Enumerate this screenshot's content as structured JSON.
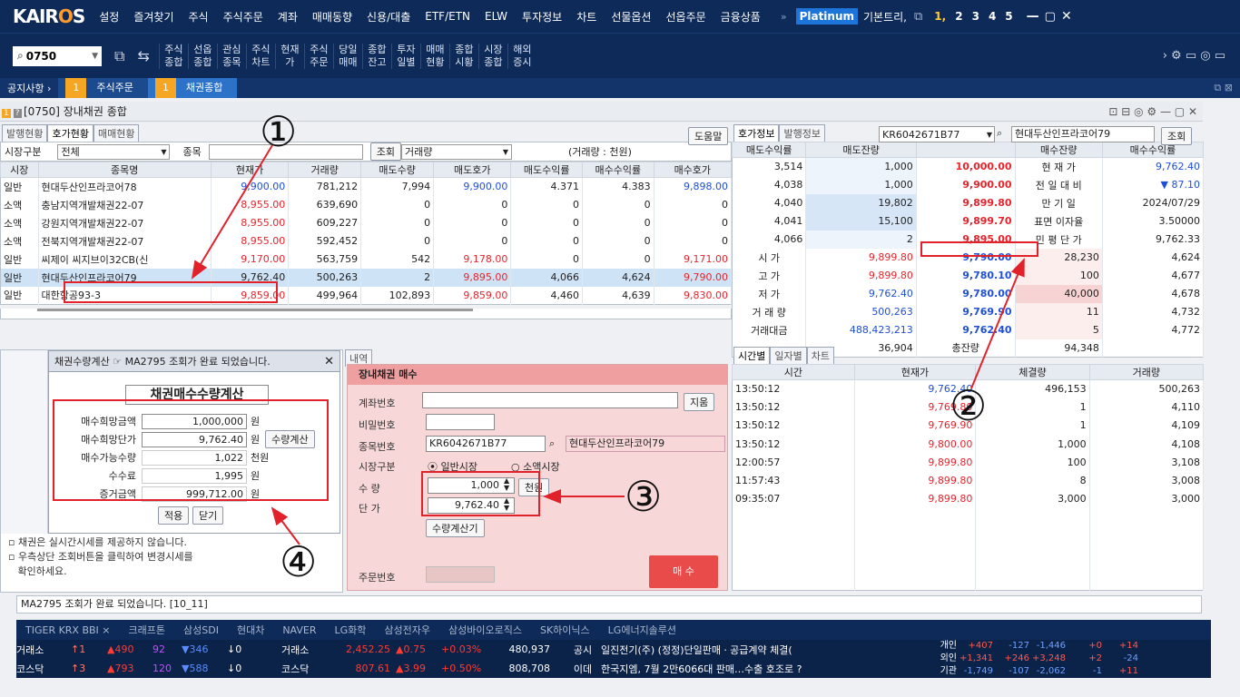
{
  "app": {
    "logo": "KAIROS",
    "plan": "Platinum",
    "layout_name": "기본트리,"
  },
  "menu": [
    "설정",
    "즐겨찾기",
    "주식",
    "주식주문",
    "계좌",
    "매매동향",
    "신용/대출",
    "ETF/ETN",
    "ELW",
    "투자정보",
    "차트",
    "선물옵션",
    "선옵주문",
    "금융상품"
  ],
  "screen_nums": [
    "1,",
    "2",
    "3",
    "4",
    "5"
  ],
  "toolbar": {
    "code": "0750",
    "items": [
      "주식\n종합",
      "선옵\n종합",
      "관심\n종목",
      "주식\n차트",
      "현재\n가",
      "주식\n주문",
      "당일\n매매",
      "종합\n잔고",
      "투자\n일별",
      "매매\n현황",
      "종합\n시황",
      "시장\n종합",
      "해외\n증시"
    ]
  },
  "tabs": {
    "notice": "공지사항 ›",
    "items": [
      "주식주문",
      "채권종합"
    ]
  },
  "window": {
    "title": "[0750] 장내채권 종합"
  },
  "left": {
    "subtabs": [
      "발행현황",
      "호가현황",
      "매매현황"
    ],
    "market_label": "시장구분",
    "market_value": "전체",
    "item_label": "종목",
    "query_btn": "조회",
    "sort_value": "거래량",
    "unit_note": "(거래량 : 천원)",
    "help_btn": "도움말",
    "headers": [
      "시장",
      "종목명",
      "현재가",
      "거래량",
      "매도수량",
      "매도호가",
      "매도수익률",
      "매수수익률",
      "매수호가"
    ],
    "rows": [
      [
        "일반",
        "현대두산인프라코어78",
        "9,900.00",
        "781,212",
        "7,994",
        "9,900.00",
        "4.371",
        "4.383",
        "9,898.00"
      ],
      [
        "소액",
        "충남지역개발채권22-07",
        "8,955.00",
        "639,690",
        "0",
        "0",
        "0",
        "0",
        "0"
      ],
      [
        "소액",
        "강원지역개발채권22-07",
        "8,955.00",
        "609,227",
        "0",
        "0",
        "0",
        "0",
        "0"
      ],
      [
        "소액",
        "전북지역개발채권22-07",
        "8,955.00",
        "592,452",
        "0",
        "0",
        "0",
        "0",
        "0"
      ],
      [
        "일반",
        "씨제이 씨지브이32CB(신",
        "9,170.00",
        "563,759",
        "542",
        "9,178.00",
        "0",
        "0",
        "9,171.00"
      ],
      [
        "일반",
        "현대두산인프라코어79",
        "9,762.40",
        "500,263",
        "2",
        "9,895.00",
        "4,066",
        "4,624",
        "9,790.00"
      ],
      [
        "일반",
        "대한항공93-3",
        "9,859.00",
        "499,964",
        "102,893",
        "9,859.00",
        "4,460",
        "4,639",
        "9,830.00"
      ]
    ]
  },
  "right": {
    "subtabs": [
      "호가정보",
      "발행정보"
    ],
    "code": "KR6042671B77",
    "name": "현대두산인프라코어79",
    "query_btn": "조회",
    "headers": [
      "매도수익률",
      "매도잔량",
      "",
      "매수잔량",
      "매수수익률"
    ],
    "asks": [
      [
        "3,514",
        "1,000",
        "10,000.00"
      ],
      [
        "4,038",
        "1,000",
        "9,900.00"
      ],
      [
        "4,040",
        "19,802",
        "9,899.80"
      ],
      [
        "4,041",
        "15,100",
        "9,899.70"
      ],
      [
        "4,066",
        "2",
        "9,895.00"
      ]
    ],
    "info": [
      [
        "현 재 가",
        "9,762.40"
      ],
      [
        "전 일 대 비",
        "▼ 87.10"
      ],
      [
        "만 기 일",
        "2024/07/29"
      ],
      [
        "표면 이자율",
        "3.50000"
      ],
      [
        "민 평 단 가",
        "9,762.33"
      ]
    ],
    "stats": [
      [
        "시 가",
        "9,899.80"
      ],
      [
        "고 가",
        "9,899.80"
      ],
      [
        "저 가",
        "9,762.40"
      ],
      [
        "거 래 량",
        "500,263"
      ],
      [
        "거래대금",
        "488,423,213"
      ]
    ],
    "bids": [
      [
        "9,790.00",
        "28,230",
        "4,624"
      ],
      [
        "9,780.10",
        "100",
        "4,677"
      ],
      [
        "9,780.00",
        "40,000",
        "4,678"
      ],
      [
        "9,769.90",
        "11",
        "4,732"
      ],
      [
        "9,762.40",
        "5",
        "4,772"
      ]
    ],
    "total_ask": "36,904",
    "total_label": "총잔량",
    "total_bid": "94,348"
  },
  "ticks": {
    "subtabs": [
      "시간별",
      "일자별",
      "차트"
    ],
    "headers": [
      "시간",
      "현재가",
      "체결량",
      "거래량"
    ],
    "rows": [
      [
        "13:50:12",
        "9,762.40",
        "496,153",
        "500,263"
      ],
      [
        "13:50:12",
        "9,769.80",
        "1",
        "4,110"
      ],
      [
        "13:50:12",
        "9,769.90",
        "1",
        "4,109"
      ],
      [
        "13:50:12",
        "9,800.00",
        "1,000",
        "4,108"
      ],
      [
        "12:00:57",
        "9,899.80",
        "100",
        "3,108"
      ],
      [
        "11:57:43",
        "9,899.80",
        "8",
        "3,008"
      ],
      [
        "09:35:07",
        "9,899.80",
        "3,000",
        "3,000"
      ]
    ]
  },
  "order": {
    "title": "장내채권 매수",
    "account_label": "계좌번호",
    "account_btn": "지움",
    "pw_label": "비밀번호",
    "code_label": "종목번호",
    "code": "KR6042671B77",
    "name": "현대두산인프라코어79",
    "market_label": "시장구분",
    "market_opt1": "일반시장",
    "market_opt2": "소액시장",
    "qty_label": "수  량",
    "qty": "1,000",
    "qty_unit": "천원",
    "price_label": "단  가",
    "price": "9,762.40",
    "calc_btn": "수량계산기",
    "ordno_label": "주문번호",
    "buy_btn": "매 수",
    "history_tab": "내역"
  },
  "dialog": {
    "title": "채권수량계산 ☞ MA2795 조회가 완료 되었습니다.",
    "heading": "채권매수수량계산",
    "rows": [
      [
        "매수희망금액",
        "1,000,000",
        "원"
      ],
      [
        "매수희망단가",
        "9,762.40",
        "원"
      ],
      [
        "매수가능수량",
        "1,022",
        "천원"
      ],
      [
        "수수료",
        "1,995",
        "원"
      ],
      [
        "증거금액",
        "999,712.00",
        "원"
      ]
    ],
    "calc_btn": "수량계산",
    "apply_btn": "적용",
    "close_btn": "닫기"
  },
  "notes": [
    "▫ 채권은 실시간시세를 제공하지 않습니다.",
    "▫ 우측상단 조회버튼을 클릭하여 변경시세를",
    "   확인하세요."
  ],
  "status": "MA2795 조회가 완료 되었습니다. [10_11]",
  "callouts": [
    "①",
    "②",
    "③",
    "④"
  ],
  "ticker_top": [
    "TIGER KRX BBI ×",
    "크래프톤",
    "삼성SDI",
    "현대차",
    "NAVER",
    "LG화학",
    "삼성전자우",
    "삼성바이오로직스",
    "SK하이닉스",
    "LG에너지솔루션"
  ],
  "market": {
    "kospi": {
      "name": "거래소",
      "up": "↑1",
      "a": "▲490",
      "b": "92",
      "c": "▼346",
      "d": "↓0",
      "label": "거래소",
      "index": "2,452.25",
      "chg": "▲0.75",
      "pct": "+0.03%",
      "vol": "480,937"
    },
    "kosdaq": {
      "name": "코스닥",
      "up": "↑3",
      "a": "▲793",
      "b": "120",
      "c": "▼588",
      "d": "↓0",
      "label": "코스닥",
      "index": "807.61",
      "chg": "▲3.99",
      "pct": "+0.50%",
      "vol": "808,708"
    },
    "news1_tag": "공시",
    "news1": "일진전기(주) (정정)단일판매ㆍ공급계약 체결(",
    "news2_tag": "이데",
    "news2": "한국지엠, 7월 2만6066대 판매…수출 호조로 ?",
    "flows": [
      [
        "개인",
        "+407",
        "-127",
        "-1,446",
        "+0",
        "+14"
      ],
      [
        "외인",
        "+1,341",
        "+246",
        "+3,248",
        "+2",
        "-24"
      ],
      [
        "기관",
        "-1,749",
        "-107",
        "-2,062",
        "-1",
        "+11"
      ]
    ]
  },
  "colors": {
    "navy": "#0d2a58",
    "red": "#e8232b",
    "blue": "#1f4fd6",
    "accent": "#f5a623"
  }
}
